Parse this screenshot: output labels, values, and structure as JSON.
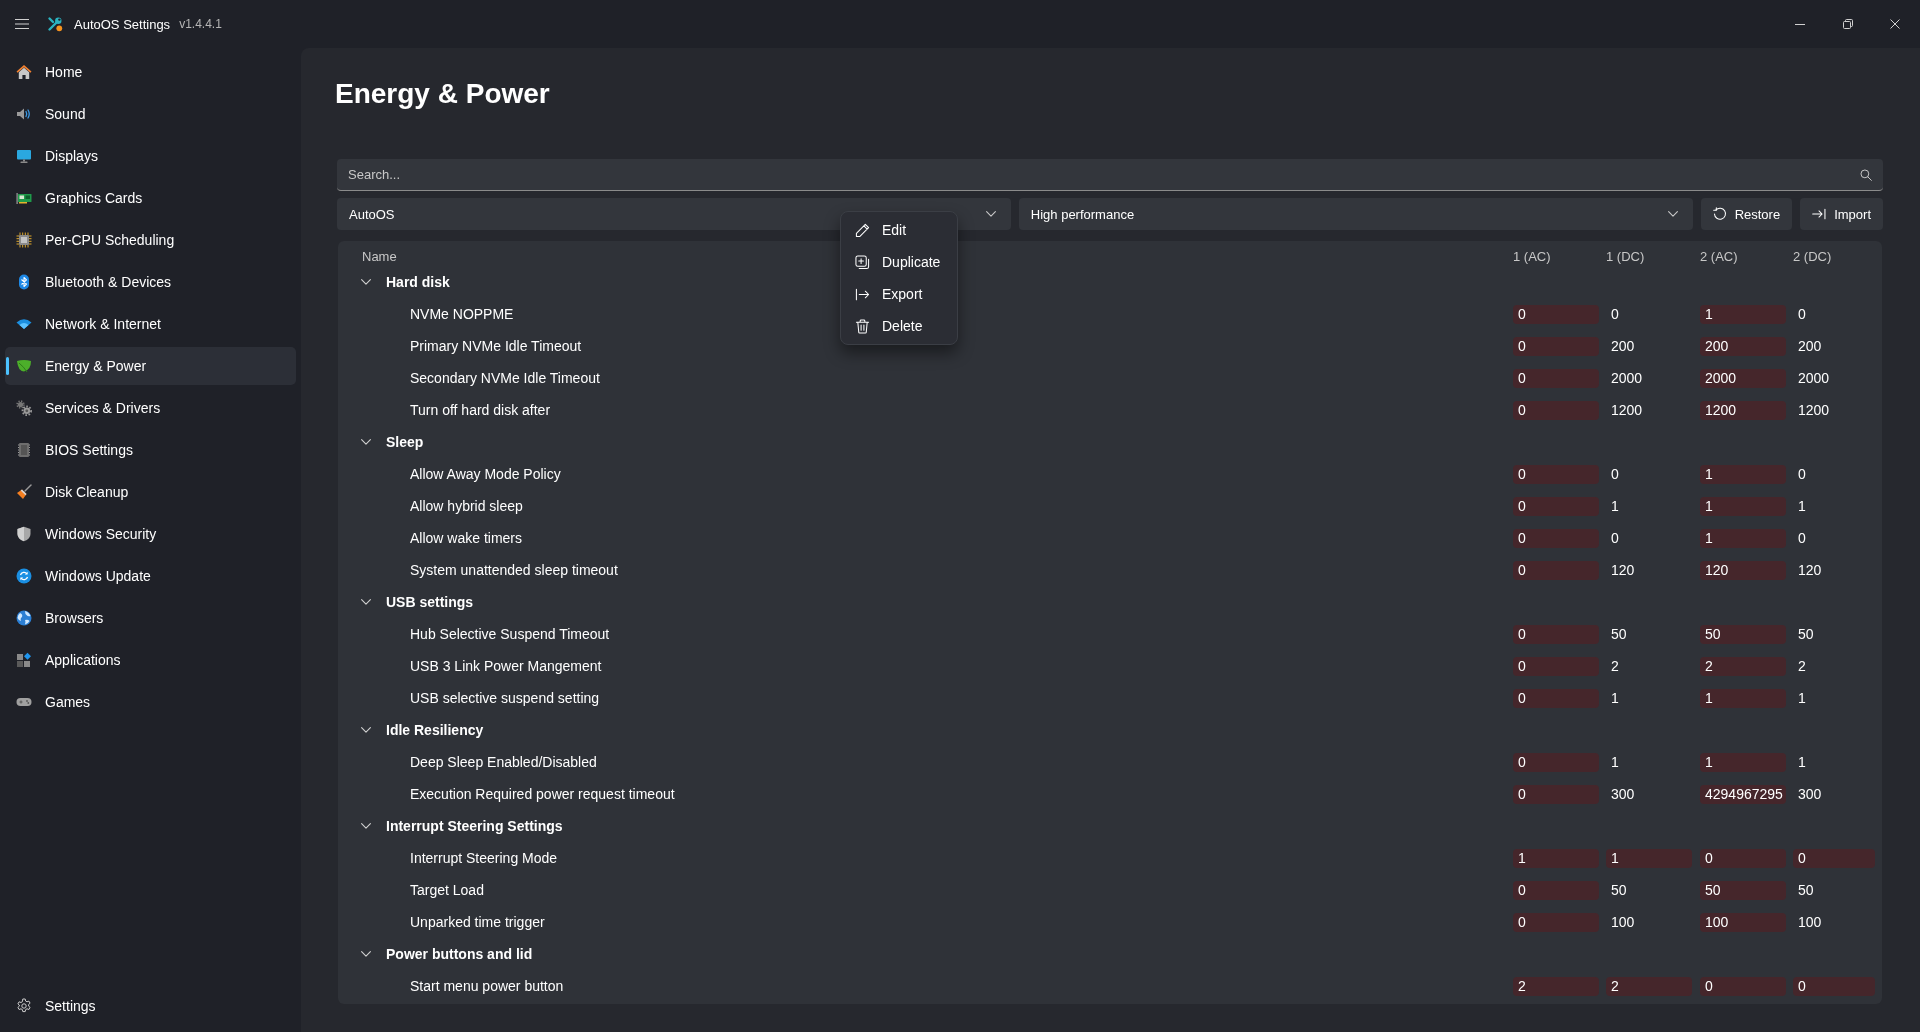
{
  "window": {
    "title": "AutoOS Settings",
    "version": "v1.4.4.1"
  },
  "sidebar": {
    "items": [
      {
        "label": "Home",
        "selected": false
      },
      {
        "label": "Sound",
        "selected": false
      },
      {
        "label": "Displays",
        "selected": false
      },
      {
        "label": "Graphics Cards",
        "selected": false
      },
      {
        "label": "Per-CPU Scheduling",
        "selected": false
      },
      {
        "label": "Bluetooth & Devices",
        "selected": false
      },
      {
        "label": "Network & Internet",
        "selected": false
      },
      {
        "label": "Energy & Power",
        "selected": true
      },
      {
        "label": "Services & Drivers",
        "selected": false
      },
      {
        "label": "BIOS Settings",
        "selected": false
      },
      {
        "label": "Disk Cleanup",
        "selected": false
      },
      {
        "label": "Windows Security",
        "selected": false
      },
      {
        "label": "Windows Update",
        "selected": false
      },
      {
        "label": "Browsers",
        "selected": false
      },
      {
        "label": "Applications",
        "selected": false
      },
      {
        "label": "Games",
        "selected": false
      }
    ],
    "footer_item": {
      "label": "Settings",
      "selected": false
    }
  },
  "page": {
    "title": "Energy & Power"
  },
  "search": {
    "placeholder": "Search..."
  },
  "toolbar": {
    "dropdowns": [
      {
        "value": "AutoOS"
      },
      {
        "value": "High performance"
      }
    ],
    "buttons": [
      "Restore",
      "Import"
    ]
  },
  "context_menu": {
    "items": [
      "Edit",
      "Duplicate",
      "Export",
      "Delete"
    ]
  },
  "table": {
    "columns": [
      "Name",
      "1 (AC)",
      "1 (DC)",
      "2 (AC)",
      "2 (DC)"
    ],
    "groups": [
      {
        "label": "Hard disk",
        "expanded": true,
        "children": [
          {
            "label": "NVMe NOPPME",
            "values": [
              {
                "text": "0",
                "highlighted": true
              },
              {
                "text": "0",
                "highlighted": false
              },
              {
                "text": "1",
                "highlighted": true
              },
              {
                "text": "0",
                "highlighted": false
              }
            ]
          },
          {
            "label": "Primary NVMe Idle Timeout",
            "values": [
              {
                "text": "0",
                "highlighted": true
              },
              {
                "text": "200",
                "highlighted": false
              },
              {
                "text": "200",
                "highlighted": true
              },
              {
                "text": "200",
                "highlighted": false
              }
            ]
          },
          {
            "label": "Secondary NVMe Idle Timeout",
            "values": [
              {
                "text": "0",
                "highlighted": true
              },
              {
                "text": "2000",
                "highlighted": false
              },
              {
                "text": "2000",
                "highlighted": true
              },
              {
                "text": "2000",
                "highlighted": false
              }
            ]
          },
          {
            "label": "Turn off hard disk after",
            "values": [
              {
                "text": "0",
                "highlighted": true
              },
              {
                "text": "1200",
                "highlighted": false
              },
              {
                "text": "1200",
                "highlighted": true
              },
              {
                "text": "1200",
                "highlighted": false
              }
            ]
          }
        ]
      },
      {
        "label": "Sleep",
        "expanded": true,
        "children": [
          {
            "label": "Allow Away Mode Policy",
            "values": [
              {
                "text": "0",
                "highlighted": true
              },
              {
                "text": "0",
                "highlighted": false
              },
              {
                "text": "1",
                "highlighted": true
              },
              {
                "text": "0",
                "highlighted": false
              }
            ]
          },
          {
            "label": "Allow hybrid sleep",
            "values": [
              {
                "text": "0",
                "highlighted": true
              },
              {
                "text": "1",
                "highlighted": false
              },
              {
                "text": "1",
                "highlighted": true
              },
              {
                "text": "1",
                "highlighted": false
              }
            ]
          },
          {
            "label": "Allow wake timers",
            "values": [
              {
                "text": "0",
                "highlighted": true
              },
              {
                "text": "0",
                "highlighted": false
              },
              {
                "text": "1",
                "highlighted": true
              },
              {
                "text": "0",
                "highlighted": false
              }
            ]
          },
          {
            "label": "System unattended sleep timeout",
            "values": [
              {
                "text": "0",
                "highlighted": true
              },
              {
                "text": "120",
                "highlighted": false
              },
              {
                "text": "120",
                "highlighted": true
              },
              {
                "text": "120",
                "highlighted": false
              }
            ]
          }
        ]
      },
      {
        "label": "USB settings",
        "expanded": true,
        "children": [
          {
            "label": "Hub Selective Suspend Timeout",
            "values": [
              {
                "text": "0",
                "highlighted": true
              },
              {
                "text": "50",
                "highlighted": false
              },
              {
                "text": "50",
                "highlighted": true
              },
              {
                "text": "50",
                "highlighted": false
              }
            ]
          },
          {
            "label": "USB 3 Link Power Mangement",
            "values": [
              {
                "text": "0",
                "highlighted": true
              },
              {
                "text": "2",
                "highlighted": false
              },
              {
                "text": "2",
                "highlighted": true
              },
              {
                "text": "2",
                "highlighted": false
              }
            ]
          },
          {
            "label": "USB selective suspend setting",
            "values": [
              {
                "text": "0",
                "highlighted": true
              },
              {
                "text": "1",
                "highlighted": false
              },
              {
                "text": "1",
                "highlighted": true
              },
              {
                "text": "1",
                "highlighted": false
              }
            ]
          }
        ]
      },
      {
        "label": "Idle Resiliency",
        "expanded": true,
        "children": [
          {
            "label": "Deep Sleep Enabled/Disabled",
            "values": [
              {
                "text": "0",
                "highlighted": true
              },
              {
                "text": "1",
                "highlighted": false
              },
              {
                "text": "1",
                "highlighted": true
              },
              {
                "text": "1",
                "highlighted": false
              }
            ]
          },
          {
            "label": "Execution Required power request timeout",
            "values": [
              {
                "text": "0",
                "highlighted": true
              },
              {
                "text": "300",
                "highlighted": false
              },
              {
                "text": "4294967295",
                "highlighted": true
              },
              {
                "text": "300",
                "highlighted": false
              }
            ]
          }
        ]
      },
      {
        "label": "Interrupt Steering Settings",
        "expanded": true,
        "children": [
          {
            "label": "Interrupt Steering Mode",
            "values": [
              {
                "text": "1",
                "highlighted": true
              },
              {
                "text": "1",
                "highlighted": true
              },
              {
                "text": "0",
                "highlighted": true
              },
              {
                "text": "0",
                "highlighted": true
              }
            ]
          },
          {
            "label": "Target Load",
            "values": [
              {
                "text": "0",
                "highlighted": true
              },
              {
                "text": "50",
                "highlighted": false
              },
              {
                "text": "50",
                "highlighted": true
              },
              {
                "text": "50",
                "highlighted": false
              }
            ]
          },
          {
            "label": "Unparked time trigger",
            "values": [
              {
                "text": "0",
                "highlighted": true
              },
              {
                "text": "100",
                "highlighted": false
              },
              {
                "text": "100",
                "highlighted": true
              },
              {
                "text": "100",
                "highlighted": false
              }
            ]
          }
        ]
      },
      {
        "label": "Power buttons and lid",
        "expanded": true,
        "children": [
          {
            "label": "Start menu power button",
            "values": [
              {
                "text": "2",
                "highlighted": true
              },
              {
                "text": "2",
                "highlighted": true
              },
              {
                "text": "0",
                "highlighted": true
              },
              {
                "text": "0",
                "highlighted": true
              }
            ]
          }
        ]
      }
    ]
  }
}
